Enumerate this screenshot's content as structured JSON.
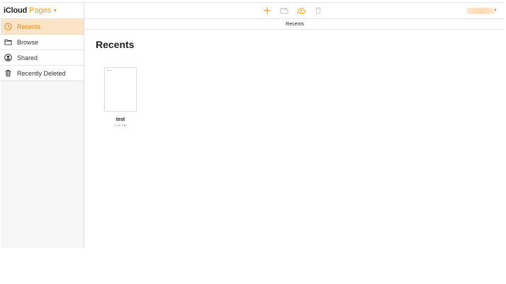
{
  "brand": {
    "name": "iCloud",
    "app": "Pages"
  },
  "sidebar": {
    "items": [
      {
        "label": "Recents",
        "icon": "clock-icon",
        "active": true
      },
      {
        "label": "Browse",
        "icon": "folder-icon",
        "active": false
      },
      {
        "label": "Shared",
        "icon": "person-circle-icon",
        "active": false
      },
      {
        "label": "Recently Deleted",
        "icon": "trash-icon",
        "active": false
      }
    ]
  },
  "toolbar": {
    "buttons": [
      "plus-icon",
      "new-folder-icon",
      "upload-icon",
      "trash-icon"
    ]
  },
  "subbar": {
    "title": "Recents"
  },
  "main": {
    "title": "Recents",
    "documents": [
      {
        "name": "test",
        "time": "2:20 PM"
      }
    ]
  },
  "colors": {
    "accent": "#f29d1c",
    "active_bg": "#fbe3c7",
    "sidebar_bg": "#f6f6f6"
  }
}
